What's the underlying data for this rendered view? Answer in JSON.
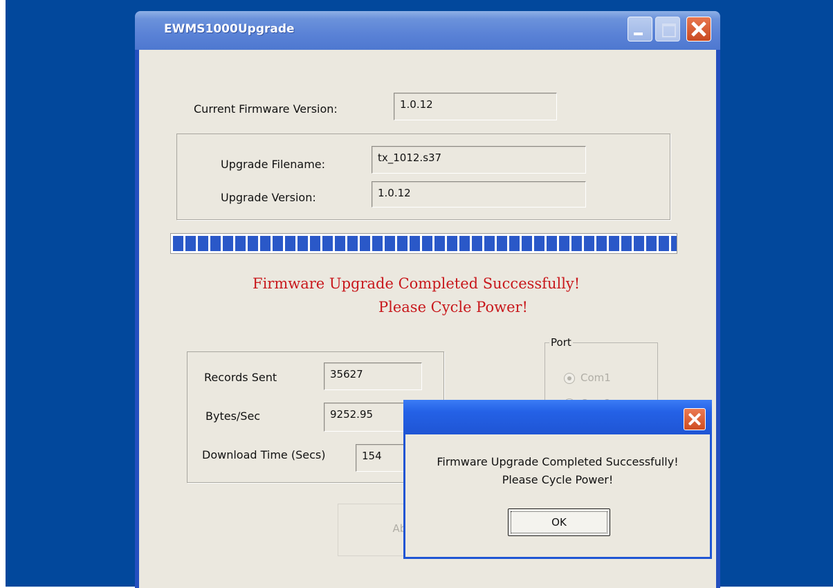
{
  "window": {
    "title": "EWMS1000Upgrade"
  },
  "current_firmware": {
    "label": "Current Firmware Version:",
    "value": "1.0.12"
  },
  "upgrade": {
    "filename_label": "Upgrade Filename:",
    "filename_value": "tx_1012.s37",
    "version_label": "Upgrade Version:",
    "version_value": "1.0.12"
  },
  "progress": {
    "percent": 100
  },
  "status_message": {
    "line1": "Firmware Upgrade Completed Successfully!",
    "line2": "Please Cycle Power!",
    "color": "#c8181c"
  },
  "stats": {
    "records_label": "Records Sent",
    "records_value": "35627",
    "bytes_label": "Bytes/Sec",
    "bytes_value": "9252.95",
    "time_label": "Download Time (Secs)",
    "time_value": "154"
  },
  "port": {
    "legend": "Port",
    "options": [
      "Com1",
      "Com2"
    ],
    "selected": "Com1"
  },
  "abort_button": {
    "label": "Abort"
  },
  "dialog": {
    "line1": "Firmware Upgrade Completed Successfully!",
    "line2": "Please Cycle Power!",
    "ok_label": "OK"
  },
  "colors": {
    "desktop": "#02489c",
    "titlebar": "#5a82d6",
    "dialog_titlebar": "#1f55d4",
    "face": "#ebe8df"
  }
}
